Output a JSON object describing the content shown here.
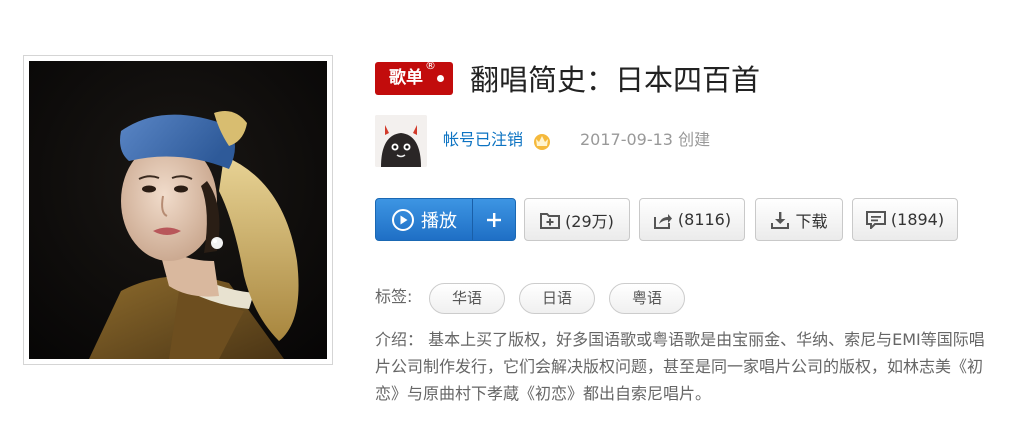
{
  "playlist": {
    "badge_label": "歌单",
    "badge_reg": "®",
    "title": "翻唱简史：日本四百首"
  },
  "creator": {
    "name": "帐号已注销",
    "create_info": "2017-09-13 创建"
  },
  "actions": {
    "play_label": "播放",
    "add_symbol": "+",
    "favorite_label": "(29万)",
    "share_label": "(8116)",
    "download_label": "下载",
    "comment_label": "(1894)"
  },
  "tags": {
    "label": "标签:",
    "items": [
      "华语",
      "日语",
      "粤语"
    ]
  },
  "description": {
    "text": "介绍： 基本上买了版权，好多国语歌或粤语歌是由宝丽金、华纳、索尼与EMI等国际唱片公司制作发行，它们会解决版权问题，甚至是同一家唱片公司的版权，如林志美《初恋》与原曲村下孝蔵《初恋》都出自索尼唱片。"
  },
  "colors": {
    "badge": "#c20c0c",
    "link": "#0c73c2",
    "play": "#2a7fd4"
  },
  "icons": {
    "play": "play-circle-icon",
    "add": "plus-icon",
    "favorite": "folder-plus-icon",
    "share": "share-icon",
    "download": "download-icon",
    "comment": "comment-icon",
    "vip": "vip-crown-icon"
  }
}
